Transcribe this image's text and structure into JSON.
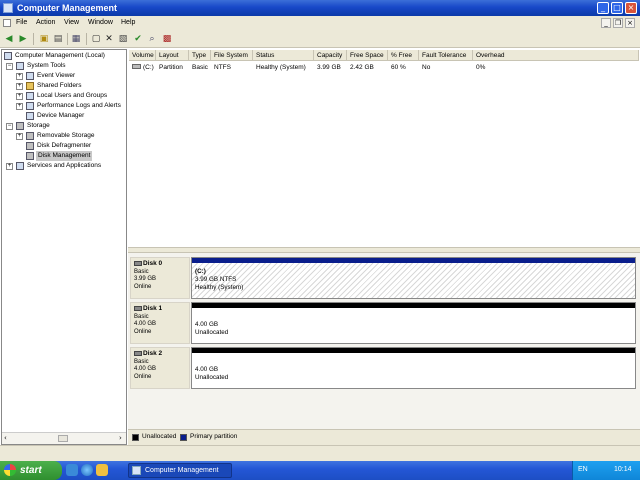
{
  "window": {
    "title": "Computer Management",
    "controls": {
      "minimize": "_",
      "maximize": "□",
      "close": "×"
    }
  },
  "menu": {
    "items": [
      "File",
      "Action",
      "View",
      "Window",
      "Help"
    ],
    "child_controls": {
      "minimize": "_",
      "restore": "❐",
      "close": "×"
    }
  },
  "toolbar": {
    "icons": [
      "back-icon",
      "forward-icon",
      "up-folder-icon",
      "show-hide-tree-icon",
      "properties-icon",
      "export-list-icon",
      "help-icon",
      "delete-icon",
      "check-icon",
      "open-icon",
      "search-icon",
      "extra-icon"
    ]
  },
  "tree": {
    "root": "Computer Management (Local)",
    "system_tools": "System Tools",
    "system_tools_items": [
      "Event Viewer",
      "Shared Folders",
      "Local Users and Groups",
      "Performance Logs and Alerts",
      "Device Manager"
    ],
    "storage": "Storage",
    "storage_items": [
      "Removable Storage",
      "Disk Defragmenter",
      "Disk Management"
    ],
    "services": "Services and Applications"
  },
  "volume_list": {
    "columns": [
      "Volume",
      "Layout",
      "Type",
      "File System",
      "Status",
      "Capacity",
      "Free Space",
      "% Free",
      "Fault Tolerance",
      "Overhead"
    ],
    "rows": [
      [
        "(C:)",
        "Partition",
        "Basic",
        "NTFS",
        "Healthy (System)",
        "3.99 GB",
        "2.42 GB",
        "60 %",
        "No",
        "0%"
      ]
    ]
  },
  "disks": [
    {
      "name": "Disk 0",
      "type": "Basic",
      "size": "3.99 GB",
      "state": "Online",
      "region_title": "(C:)",
      "region_line1": "3.99 GB NTFS",
      "region_line2": "Healthy (System)"
    },
    {
      "name": "Disk 1",
      "type": "Basic",
      "size": "4.00 GB",
      "state": "Online",
      "region_title": "",
      "region_line1": "4.00 GB",
      "region_line2": "Unallocated"
    },
    {
      "name": "Disk 2",
      "type": "Basic",
      "size": "4.00 GB",
      "state": "Online",
      "region_title": "",
      "region_line1": "4.00 GB",
      "region_line2": "Unallocated"
    }
  ],
  "legend": {
    "unallocated": "Unallocated",
    "primary": "Primary partition",
    "unallocated_color": "#000000",
    "primary_color": "#0a1e8c"
  },
  "taskbar": {
    "start": "start",
    "task": "Computer Management",
    "language": "EN",
    "clock": "10:14"
  }
}
